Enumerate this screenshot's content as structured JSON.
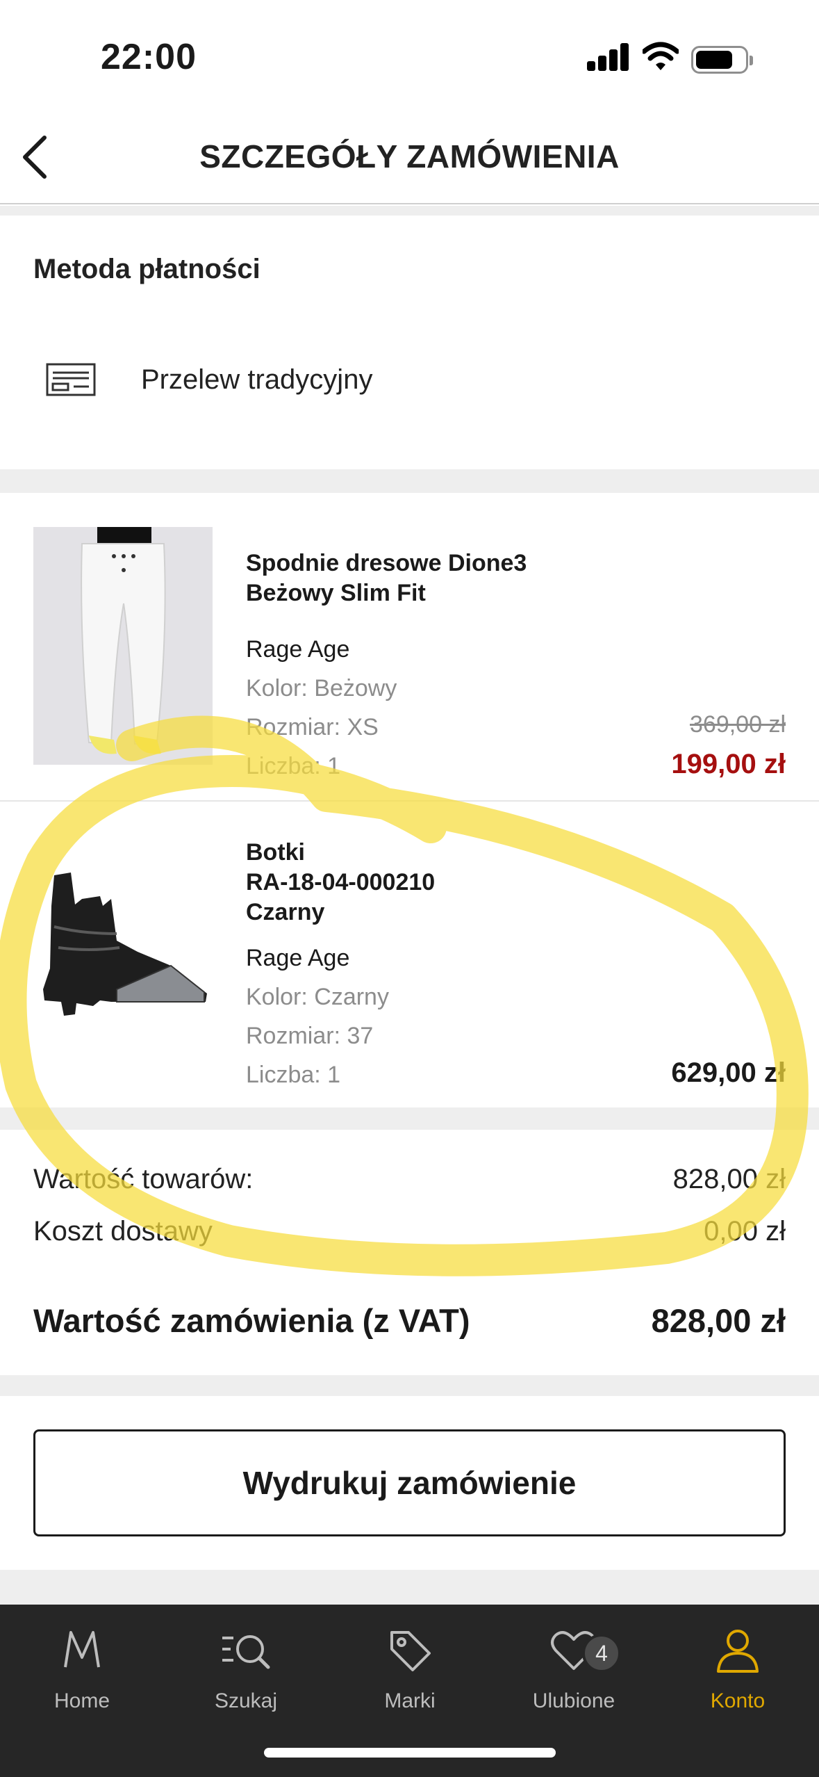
{
  "status_bar": {
    "time": "22:00"
  },
  "header": {
    "title": "SZCZEGÓŁY ZAMÓWIENIA"
  },
  "payment": {
    "title": "Metoda płatności",
    "method": "Przelew tradycyjny"
  },
  "products": [
    {
      "name_line1": "Spodnie dresowe Dione3",
      "name_line2": "Beżowy Slim Fit",
      "brand": "Rage Age",
      "color": "Kolor: Beżowy",
      "size": "Rozmiar: XS",
      "quantity": "Liczba: 1",
      "old_price": "369,00 zł",
      "price": "199,00 zł",
      "price_color": "#a50f0f"
    },
    {
      "name_line1": "Botki",
      "name_line2": "RA-18-04-000210",
      "name_line3": "Czarny",
      "brand": "Rage Age",
      "color": "Kolor: Czarny",
      "size": "Rozmiar: 37",
      "quantity": "Liczba: 1",
      "price": "629,00 zł"
    }
  ],
  "summary": {
    "goods_label": "Wartość towarów:",
    "goods_value": "828,00 zł",
    "delivery_label": "Koszt dostawy",
    "delivery_value": "0,00 zł",
    "total_label": "Wartość zamówienia (z VAT)",
    "total_value": "828,00 zł"
  },
  "print_button": "Wydrukuj zamówienie",
  "tabbar": {
    "items": [
      {
        "label": "Home",
        "icon": "m-logo-icon"
      },
      {
        "label": "Szukaj",
        "icon": "search-icon"
      },
      {
        "label": "Marki",
        "icon": "tag-icon"
      },
      {
        "label": "Ulubione",
        "icon": "heart-icon",
        "badge": "4"
      },
      {
        "label": "Konto",
        "icon": "user-icon",
        "active": true
      }
    ],
    "active_color": "#e0a800"
  },
  "annotation_color": "#f7dc3c"
}
